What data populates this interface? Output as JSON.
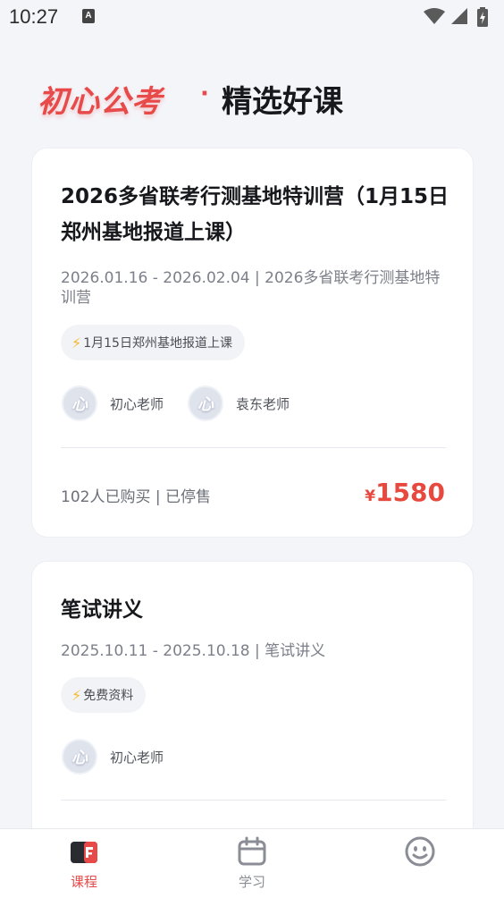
{
  "status_bar": {
    "time": "10:27",
    "notification_icon": "a-letter-icon"
  },
  "brand": {
    "name": "初心公考",
    "separator": "·",
    "subtitle": "精选好课"
  },
  "courses": [
    {
      "title": "2026多省联考行测基地特训营（1月15日郑州基地报道上课）",
      "meta": "2026.01.16 - 2026.02.04 | 2026多省联考行测基地特训营",
      "tag": "1月15日郑州基地报道上课",
      "teachers": [
        "初心老师",
        "袁东老师"
      ],
      "purchase_status": "102人已购买 | 已停售",
      "price_symbol": "¥",
      "price": "1580"
    },
    {
      "title": "笔试讲义",
      "meta": "2025.10.11 - 2025.10.18 | 笔试讲义",
      "tag": "免费资料",
      "teachers": [
        "初心老师"
      ]
    }
  ],
  "avatar_text": "心",
  "bottom_nav": [
    {
      "label": "课程",
      "icon": "course-book-icon",
      "active": true
    },
    {
      "label": "学习",
      "icon": "calendar-icon",
      "active": false
    },
    {
      "label": "",
      "icon": "smiley-face-icon",
      "active": false
    }
  ],
  "colors": {
    "accent": "#e84a4a",
    "price": "#e8493f",
    "bolt": "#f5b928"
  }
}
